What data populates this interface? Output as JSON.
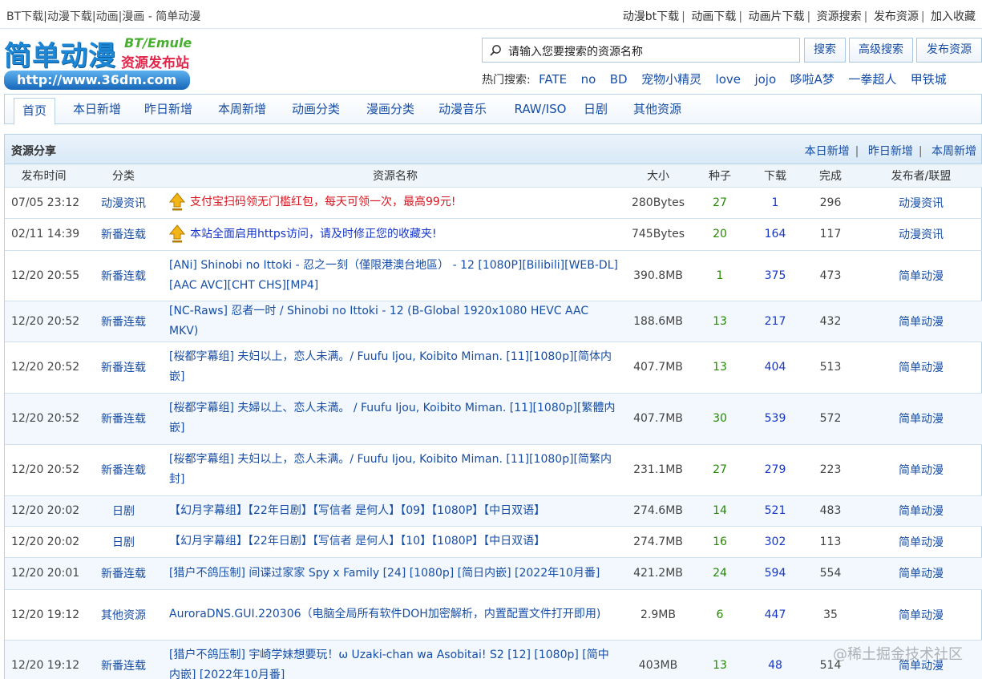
{
  "page": {
    "title": "BT下载|动漫下载|动画|漫画 - 简单动漫"
  },
  "toplinks": [
    "动漫bt下载",
    "动画下载",
    "动画片下载",
    "资源搜索",
    "发布资源",
    "加入收藏"
  ],
  "logo": {
    "main": "简单动漫",
    "tag": "BT/Emule",
    "sub": "资源发布站",
    "url": "http://www.36dm.com"
  },
  "search": {
    "placeholder": "请输入您要搜索的资源名称",
    "search_btn": "搜索",
    "advanced_btn": "高级搜索",
    "publish_btn": "发布资源"
  },
  "hot": {
    "label": "热门搜索:",
    "terms": [
      "FATE",
      "no",
      "BD",
      "宠物小精灵",
      "love",
      "jojo",
      "哆啦A梦",
      "一拳超人",
      "甲铁城"
    ]
  },
  "nav": {
    "tabs": [
      "首页",
      "本日新增",
      "昨日新增",
      "本周新增",
      "动画分类",
      "漫画分类",
      "动漫音乐",
      "RAW/ISO",
      "日剧",
      "其他资源"
    ],
    "active": 0
  },
  "panel": {
    "title": "资源分享",
    "links": [
      "本日新增",
      "昨日新增",
      "本周新增"
    ]
  },
  "table": {
    "headers": [
      "发布时间",
      "分类",
      "资源名称",
      "大小",
      "种子",
      "下载",
      "完成",
      "发布者/联盟"
    ],
    "rows": [
      {
        "time": "07/05 23:12",
        "cat": "动漫资讯",
        "name": "支付宝扫码领无门槛红包，每天可领一次，最高99元!",
        "size": "280Bytes",
        "seeds": "27",
        "dl": "1",
        "done": "296",
        "pub": "动漫资讯",
        "sticky": "red"
      },
      {
        "time": "02/11 14:39",
        "cat": "新番连载",
        "name": "本站全面启用https访问，请及时修正您的收藏夹!",
        "size": "745Bytes",
        "seeds": "20",
        "dl": "164",
        "done": "117",
        "pub": "动漫资讯",
        "sticky": "blue"
      },
      {
        "time": "12/20 20:55",
        "cat": "新番连载",
        "name": "[ANi] Shinobi no Ittoki - 忍之一刻（僅限港澳台地區） - 12 [1080P][Bilibili][WEB-DL][AAC AVC][CHT CHS][MP4]",
        "size": "390.8MB",
        "seeds": "1",
        "dl": "375",
        "done": "473",
        "pub": "简单动漫"
      },
      {
        "time": "12/20 20:52",
        "cat": "新番连载",
        "name": "[NC-Raws] 忍者一时 / Shinobi no Ittoki - 12 (B-Global 1920x1080 HEVC AAC MKV)",
        "size": "188.6MB",
        "seeds": "13",
        "dl": "217",
        "done": "432",
        "pub": "简单动漫"
      },
      {
        "time": "12/20 20:52",
        "cat": "新番连载",
        "name": "[桜都字幕组] 夫妇以上，恋人未满。/ Fuufu Ijou, Koibito Miman. [11][1080p][简体内嵌]",
        "size": "407.7MB",
        "seeds": "13",
        "dl": "404",
        "done": "513",
        "pub": "简单动漫"
      },
      {
        "time": "12/20 20:52",
        "cat": "新番连载",
        "name": "[桜都字幕组] 夫婦以上、恋人未満。 / Fuufu Ijou, Koibito Miman. [11][1080p][繁體内嵌]",
        "size": "407.7MB",
        "seeds": "30",
        "dl": "539",
        "done": "572",
        "pub": "简单动漫"
      },
      {
        "time": "12/20 20:52",
        "cat": "新番连载",
        "name": "[桜都字幕组] 夫妇以上，恋人未满。/ Fuufu Ijou, Koibito Miman. [11][1080p][简繁内封]",
        "size": "231.1MB",
        "seeds": "27",
        "dl": "279",
        "done": "223",
        "pub": "简单动漫"
      },
      {
        "time": "12/20 20:02",
        "cat": "日剧",
        "name": "【幻月字幕组】【22年日剧】【写信者 是何人】【09】【1080P】【中日双语】",
        "size": "274.6MB",
        "seeds": "14",
        "dl": "521",
        "done": "483",
        "pub": "简单动漫"
      },
      {
        "time": "12/20 20:02",
        "cat": "日剧",
        "name": "【幻月字幕组】【22年日剧】【写信者 是何人】【10】【1080P】【中日双语】",
        "size": "274.7MB",
        "seeds": "16",
        "dl": "302",
        "done": "113",
        "pub": "简单动漫"
      },
      {
        "time": "12/20 20:01",
        "cat": "新番连载",
        "name": "[猎户不鸽压制] 间谍过家家 Spy x Family [24] [1080p] [简日内嵌] [2022年10月番]",
        "size": "421.2MB",
        "seeds": "24",
        "dl": "594",
        "done": "554",
        "pub": "简单动漫"
      },
      {
        "time": "12/20 19:12",
        "cat": "其他资源",
        "name": "AuroraDNS.GUI.220306（电脑全局所有软件DOH加密解析，内置配置文件打开即用)",
        "size": "2.9MB",
        "seeds": "6",
        "dl": "447",
        "done": "35",
        "pub": "简单动漫"
      },
      {
        "time": "12/20 19:12",
        "cat": "新番连载",
        "name": "[猎户不鸽压制] 宇崎学妹想要玩！ω Uzaki-chan wa Asobitai! S2 [12] [1080p] [简中内嵌] [2022年10月番]",
        "size": "403MB",
        "seeds": "13",
        "dl": "48",
        "done": "514",
        "pub": "简单动漫"
      }
    ]
  },
  "watermark": "@稀土掘金技术社区",
  "icons": {
    "search": "magnifier-icon",
    "sticky": "up-arrow-icon"
  }
}
